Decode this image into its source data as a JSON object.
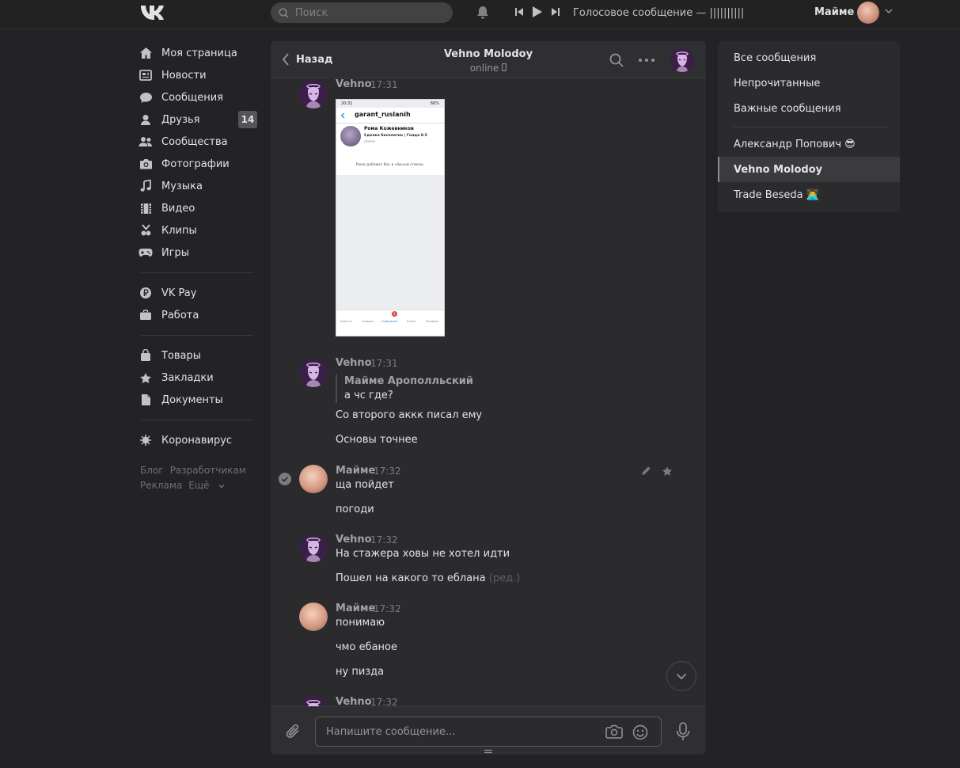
{
  "header": {
    "search_placeholder": "Поиск",
    "player_title": "Голосовое сообщение — ||||||||||||||||...",
    "user_name": "Майме"
  },
  "nav": {
    "items": [
      {
        "label": "Моя страница",
        "icon": "home-icon"
      },
      {
        "label": "Новости",
        "icon": "news-icon"
      },
      {
        "label": "Сообщения",
        "icon": "messages-icon"
      },
      {
        "label": "Друзья",
        "icon": "friends-icon",
        "badge": "14"
      },
      {
        "label": "Сообщества",
        "icon": "communities-icon"
      },
      {
        "label": "Фотографии",
        "icon": "camera-icon"
      },
      {
        "label": "Музыка",
        "icon": "music-icon"
      },
      {
        "label": "Видео",
        "icon": "video-icon"
      },
      {
        "label": "Клипы",
        "icon": "clips-icon"
      },
      {
        "label": "Игры",
        "icon": "gamepad-icon"
      }
    ],
    "items2": [
      {
        "label": "VK Pay",
        "icon": "vkpay-icon"
      },
      {
        "label": "Работа",
        "icon": "briefcase-icon"
      }
    ],
    "items3": [
      {
        "label": "Товары",
        "icon": "bag-icon"
      },
      {
        "label": "Закладки",
        "icon": "star-icon"
      },
      {
        "label": "Документы",
        "icon": "document-icon"
      }
    ],
    "items4": [
      {
        "label": "Коронавирус",
        "icon": "virus-icon"
      }
    ],
    "footer": {
      "blog": "Блог",
      "dev": "Разработчикам",
      "ads": "Реклама",
      "more": "Ещё"
    }
  },
  "chat": {
    "back_label": "Назад",
    "title": "Vehno Molodoy",
    "status": "online",
    "messages": [
      {
        "author": "Vehno",
        "time": "17:31"
      },
      {
        "author": "Vehno",
        "time": "17:31",
        "quote_author": "Майме Арополльский",
        "quote_text": "а чс где?",
        "lines": [
          "Со второго аккк писал ему",
          "Основы точнее"
        ]
      },
      {
        "author": "Майме",
        "time": "17:32",
        "lines": [
          "ща пойдет",
          "погоди"
        ]
      },
      {
        "author": "Vehno",
        "time": "17:32",
        "lines": [
          "На стажера ховы не хотел идти",
          "Пошел на какого то еблана"
        ],
        "edited": "(ред.)"
      },
      {
        "author": "Майме",
        "time": "17:32",
        "lines": [
          "понимаю",
          "чмо ебаное",
          "ну пизда"
        ]
      },
      {
        "author": "Vehno",
        "time": "17:32"
      }
    ],
    "screenshot": {
      "status_time": "20:31",
      "battery": "66%",
      "username": "garant_ruslanih",
      "profile_name": "Рома Кожевников",
      "profile_sub": "Сделка бесплатно | Голда 0.5",
      "profile_status": "online",
      "blocked_text": "Рома добавил Вас в чёрный список.",
      "tabs": [
        "Новости",
        "Сервисы",
        "Сообщения",
        "Клипы",
        "Профиль"
      ],
      "tab_badge": "1"
    },
    "composer_placeholder": "Напишите сообщение..."
  },
  "right_menu": {
    "items": [
      "Все сообщения",
      "Непрочитанные",
      "Важные сообщения"
    ],
    "convs": [
      "Александр Попович 😎",
      "Vehno Molodoy",
      "Trade Beseda 👨‍💻"
    ],
    "selected": "Vehno Molodoy"
  }
}
